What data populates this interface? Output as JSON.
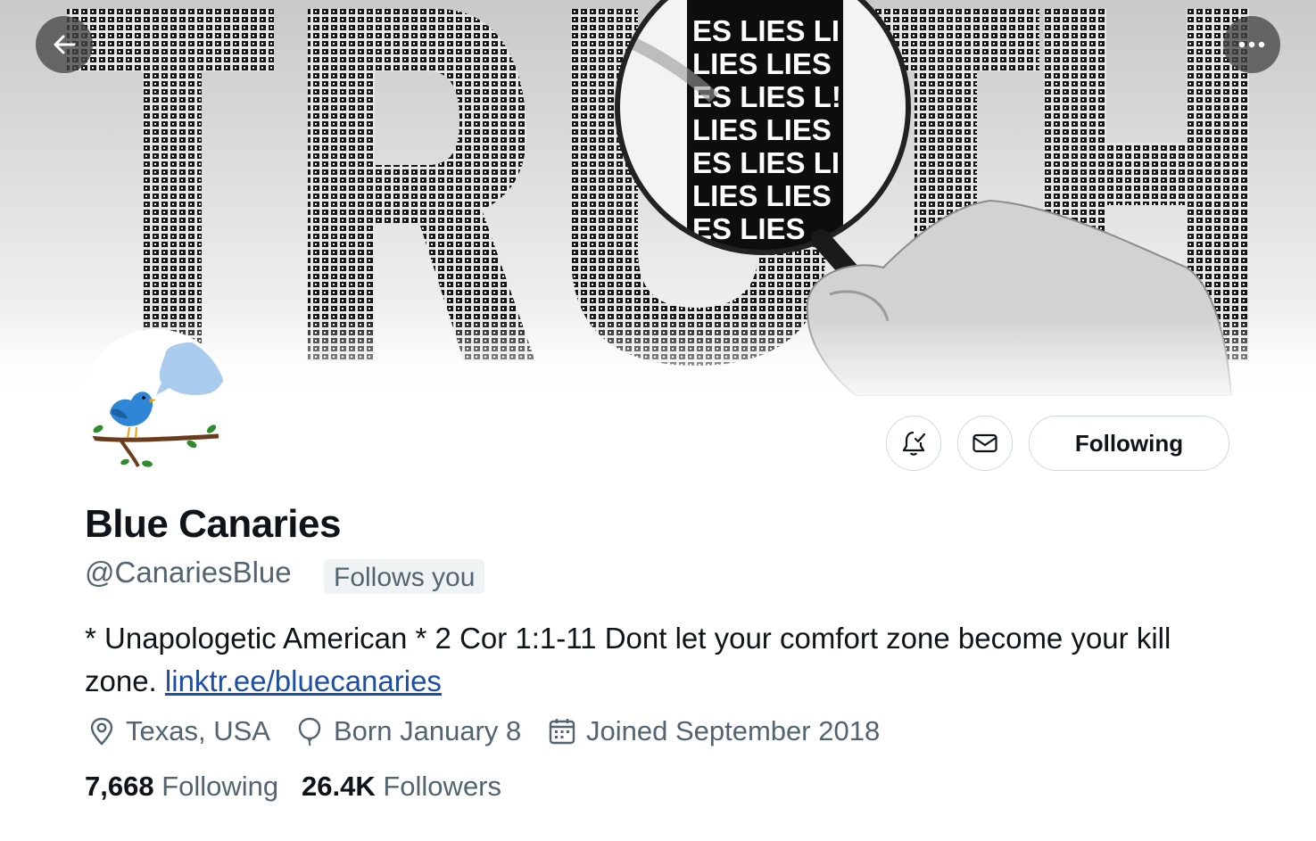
{
  "banner": {
    "big_word": "TRUTH",
    "lens_lines": [
      "ES LIES LI",
      "LIES LIES",
      "ES LIES L!",
      "LIES LIES",
      "ES LIES LI",
      "LIES LIES",
      "ES LIES"
    ]
  },
  "nav": {
    "back_icon": "arrow-left-icon",
    "more_icon": "more-horizontal-icon"
  },
  "profile": {
    "display_name": "Blue Canaries",
    "handle": "@CanariesBlue",
    "follows_you": "Follows you",
    "bio_text": "* Unapologetic American * 2 Cor 1:1-11 Dont let your comfort zone become your kill zone. ",
    "bio_link": "linktr.ee/bluecanaries",
    "location": "Texas, USA",
    "birthday": "Born January 8",
    "joined": "Joined September 2018",
    "following_count": "7,668",
    "following_label": "Following",
    "followers_count": "26.4K",
    "followers_label": "Followers"
  },
  "actions": {
    "notify_icon": "bell-check-icon",
    "message_icon": "envelope-icon",
    "following_button": "Following"
  },
  "colors": {
    "text_primary": "#0f1419",
    "text_secondary": "#536471",
    "link": "#1d4ea3",
    "border": "#cfd9de"
  }
}
